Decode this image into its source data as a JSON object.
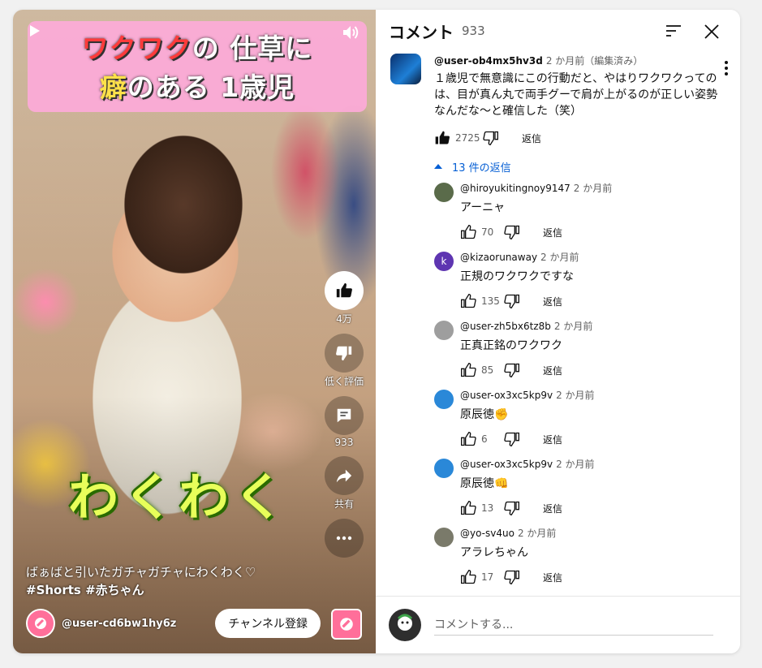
{
  "video": {
    "banner_line1_red": "ワクワク",
    "banner_line1_rest": "の 仕草に",
    "banner_line2_yellow": "癖",
    "banner_line2_rest": "のある 1歳児",
    "overlay_text": "わくわく",
    "actions": {
      "like_count": "4万",
      "dislike_label": "低く評価",
      "comment_count": "933",
      "share_label": "共有"
    },
    "caption_line1": "ばぁばと引いたガチャガチャにわくわく♡",
    "caption_line2": "#Shorts #赤ちゃん",
    "channel_name": "@user-cd6bw1hy6z",
    "subscribe_label": "チャンネル登録"
  },
  "panel": {
    "title": "コメント",
    "count": "933",
    "top_comment": {
      "author": "@user-ob4mx5hv3d",
      "time": "2 か月前（編集済み）",
      "text": "１歳児で無意識にこの行動だと、やはりワクワクってのは、目が真ん丸で両手グーで肩が上がるのが正しい姿勢なんだな～と確信した（笑）",
      "likes": "2725",
      "reply_label": "返信",
      "replies_toggle": "13 件の返信"
    },
    "replies": [
      {
        "author": "@hiroyukitingnoy9147",
        "time": "2 か月前",
        "text": "アーニャ",
        "likes": "70",
        "reply_label": "返信",
        "avatar_color": "#5a6b4a"
      },
      {
        "author": "@kizaorunaway",
        "time": "2 か月前",
        "text": "正規のワクワクですな",
        "likes": "135",
        "reply_label": "返信",
        "avatar_color": "#5e35b1",
        "avatar_letter": "k"
      },
      {
        "author": "@user-zh5bx6tz8b",
        "time": "2 か月前",
        "text": "正真正銘のワクワク",
        "likes": "85",
        "reply_label": "返信",
        "avatar_color": "#9e9e9e"
      },
      {
        "author": "@user-ox3xc5kp9v",
        "time": "2 か月前",
        "text": "原辰徳✊",
        "likes": "6",
        "reply_label": "返信",
        "avatar_color": "#2a88d8"
      },
      {
        "author": "@user-ox3xc5kp9v",
        "time": "2 か月前",
        "text": "原辰徳👊",
        "likes": "13",
        "reply_label": "返信",
        "avatar_color": "#2a88d8"
      },
      {
        "author": "@yo-sv4uo",
        "time": "2 か月前",
        "text": "アラレちゃん",
        "likes": "17",
        "reply_label": "返信",
        "avatar_color": "#7a7a6a"
      }
    ],
    "composer_placeholder": "コメントする..."
  }
}
